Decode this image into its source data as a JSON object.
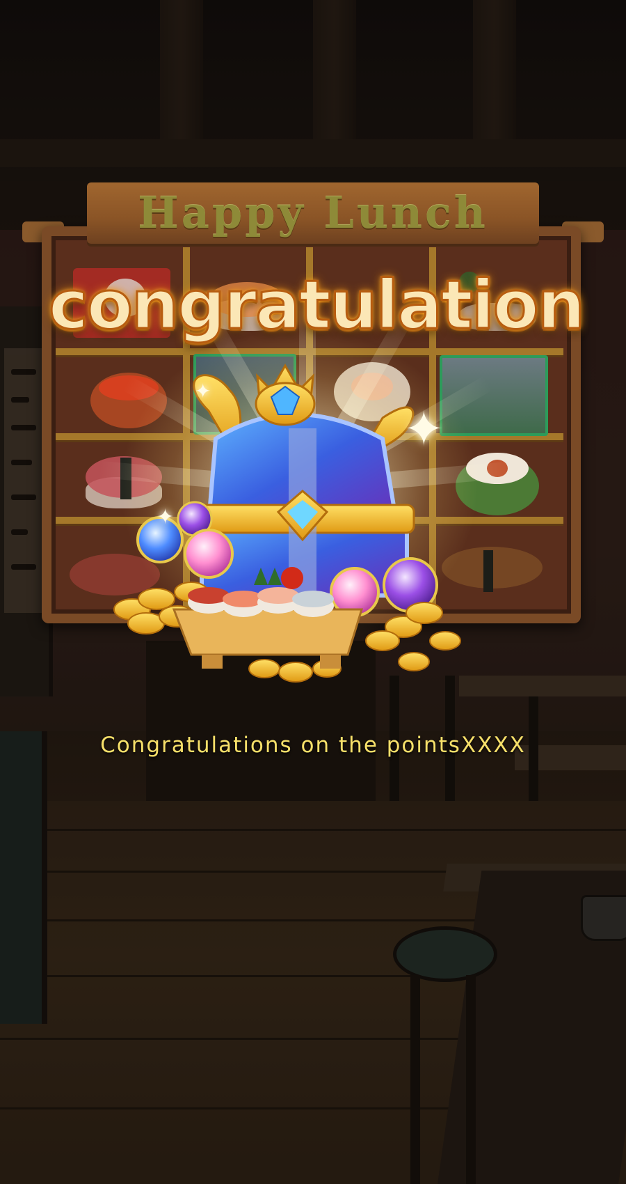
{
  "game": {
    "title": "Happy Lunch",
    "banner": "congratulation",
    "message": "Congratulations on the pointsXXXX"
  },
  "reel_symbols": [
    "lucky-cat-card",
    "salmon-nigiri",
    "sushi-set",
    "wasabi-roll",
    "salmon-roe-gunkan",
    "cat-card",
    "salmon-sashimi-roll",
    "cat-card-green",
    "tuna-nigiri",
    "tuna-nigiri-2",
    "tuna-nigiri-3",
    "cucumber-roll",
    "tuna-sashimi",
    "eel-nigiri",
    "eel-nigiri-2",
    "eel-nigiri-3"
  ],
  "reward": {
    "icon": "treasure-chest-icon",
    "items": [
      "crown-icon",
      "gold-coin-icon",
      "magic-orb-icon",
      "sushi-platter-icon"
    ]
  },
  "colors": {
    "title_text": "#8e8a38",
    "banner_fill": "#fbe7b6",
    "banner_outline": "#b75d10",
    "message_text": "#f7e06a",
    "board_wood": "#5a2e1c",
    "shelf_gold": "#a5782a"
  }
}
